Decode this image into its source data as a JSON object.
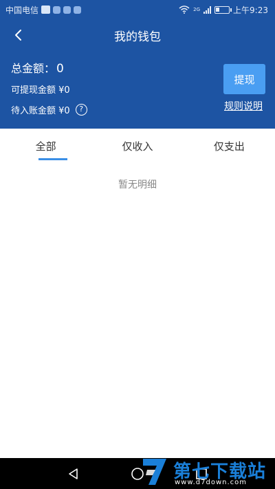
{
  "status_bar": {
    "carrier": "中国电信",
    "network": "2G",
    "time": "上午9:23"
  },
  "nav": {
    "title": "我的钱包"
  },
  "wallet": {
    "total_label": "总金额：",
    "total_value": "0",
    "withdrawable": "可提现金额 ¥0",
    "pending": "待入账金额 ¥0",
    "help_symbol": "?"
  },
  "actions": {
    "withdraw": "提现",
    "rules": "规则说明"
  },
  "tabs": [
    {
      "label": "全部",
      "active": true
    },
    {
      "label": "仅收入",
      "active": false
    },
    {
      "label": "仅支出",
      "active": false
    }
  ],
  "empty_text": "暂无明细",
  "watermark": {
    "text": "第七下载站",
    "url": "www.d7down.com"
  },
  "colors": {
    "header": "#1d54a3",
    "button": "#4a9ef2",
    "tab_indicator": "#3a8ee6"
  }
}
